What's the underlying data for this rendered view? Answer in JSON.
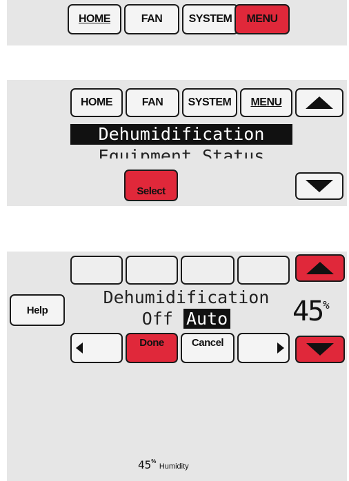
{
  "screen1": {
    "tabs": [
      {
        "label": "HOME"
      },
      {
        "label": "FAN"
      },
      {
        "label": "SYSTEM"
      },
      {
        "label": "MENU"
      }
    ]
  },
  "screen2": {
    "tabs": [
      {
        "label": "HOME"
      },
      {
        "label": "FAN"
      },
      {
        "label": "SYSTEM"
      },
      {
        "label": "MENU"
      }
    ],
    "menu_items": [
      {
        "label": "Dehumidification"
      },
      {
        "label": "Equipment Status"
      }
    ],
    "select_label": "Select"
  },
  "screen3": {
    "help_label": "Help",
    "setting_title": "Dehumidification",
    "option_off": "Off",
    "option_auto": "Auto",
    "value": "45",
    "value_unit": "%",
    "done_label": "Done",
    "cancel_label": "Cancel",
    "footer_value": "45",
    "footer_unit": "%",
    "footer_label": "Humidity"
  },
  "colors": {
    "active_red": "#e0283a",
    "panel_gray": "#e6e6e6"
  }
}
